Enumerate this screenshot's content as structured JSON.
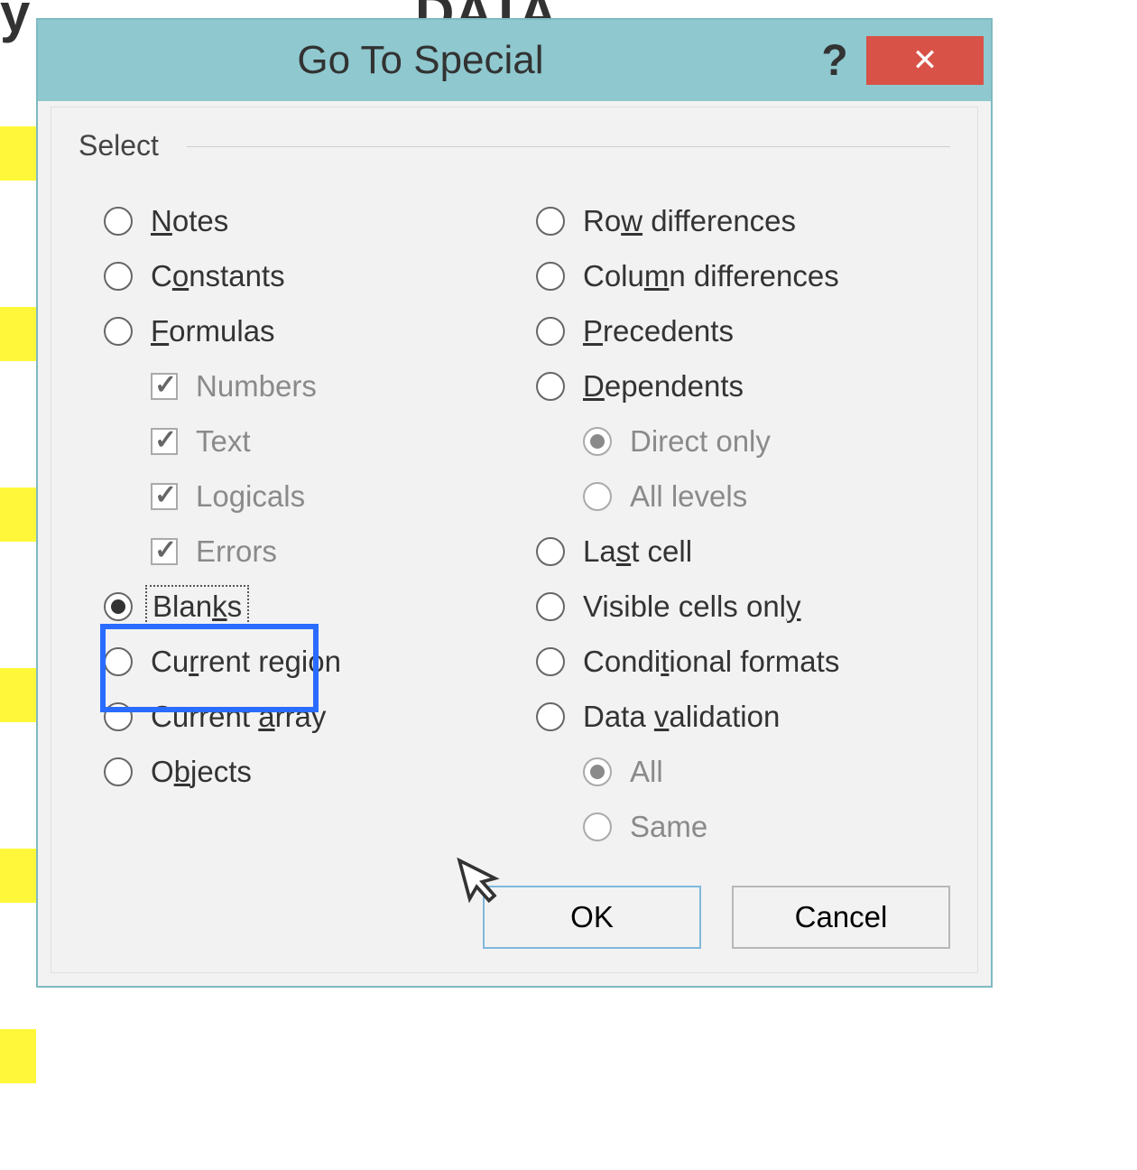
{
  "background": {
    "left_label": "y",
    "right_label": "DATA"
  },
  "dialog": {
    "title": "Go To Special",
    "help_symbol": "?",
    "close_symbol": "✕",
    "group_label": "Select",
    "left_options": [
      {
        "key": "notes",
        "label": "Notes",
        "uchar": "N",
        "type": "radio",
        "checked": false
      },
      {
        "key": "constants",
        "label": "Constants",
        "uchar": "o",
        "type": "radio",
        "checked": false
      },
      {
        "key": "formulas",
        "label": "Formulas",
        "uchar": "F",
        "type": "radio",
        "checked": false
      },
      {
        "key": "numbers",
        "label": "Numbers",
        "uchar": "",
        "type": "check",
        "checked": true,
        "sub": true
      },
      {
        "key": "text",
        "label": "Text",
        "uchar": "",
        "type": "check",
        "checked": true,
        "sub": true
      },
      {
        "key": "logicals",
        "label": "Logicals",
        "uchar": "",
        "type": "check",
        "checked": true,
        "sub": true
      },
      {
        "key": "errors",
        "label": "Errors",
        "uchar": "",
        "type": "check",
        "checked": true,
        "sub": true
      },
      {
        "key": "blanks",
        "label": "Blanks",
        "uchar": "k",
        "type": "radio",
        "checked": true,
        "focused": true
      },
      {
        "key": "current-region",
        "label": "Current region",
        "uchar": "r",
        "type": "radio",
        "checked": false
      },
      {
        "key": "current-array",
        "label": "Current array",
        "uchar": "a",
        "type": "radio",
        "checked": false
      },
      {
        "key": "objects",
        "label": "Objects",
        "uchar": "b",
        "type": "radio",
        "checked": false
      }
    ],
    "right_options": [
      {
        "key": "row-diff",
        "label": "Row differences",
        "uchar": "w",
        "type": "radio",
        "checked": false
      },
      {
        "key": "col-diff",
        "label": "Column differences",
        "uchar": "m",
        "type": "radio",
        "checked": false
      },
      {
        "key": "precedents",
        "label": "Precedents",
        "uchar": "P",
        "type": "radio",
        "checked": false
      },
      {
        "key": "dependents",
        "label": "Dependents",
        "uchar": "D",
        "type": "radio",
        "checked": false
      },
      {
        "key": "direct-only",
        "label": "Direct only",
        "uchar": "",
        "type": "radio",
        "checked": true,
        "sub": true
      },
      {
        "key": "all-levels",
        "label": "All levels",
        "uchar": "",
        "type": "radio",
        "checked": false,
        "sub": true
      },
      {
        "key": "last-cell",
        "label": "Last cell",
        "uchar": "s",
        "type": "radio",
        "checked": false
      },
      {
        "key": "visible",
        "label": "Visible cells only",
        "uchar": "y",
        "type": "radio",
        "checked": false
      },
      {
        "key": "cond-formats",
        "label": "Conditional formats",
        "uchar": "t",
        "type": "radio",
        "checked": false
      },
      {
        "key": "data-validation",
        "label": "Data validation",
        "uchar": "v",
        "type": "radio",
        "checked": false
      },
      {
        "key": "all",
        "label": "All",
        "uchar": "",
        "type": "radio",
        "checked": true,
        "sub": true
      },
      {
        "key": "same",
        "label": "Same",
        "uchar": "",
        "type": "radio",
        "checked": false,
        "sub": true
      }
    ],
    "buttons": {
      "ok": "OK",
      "cancel": "Cancel"
    }
  }
}
